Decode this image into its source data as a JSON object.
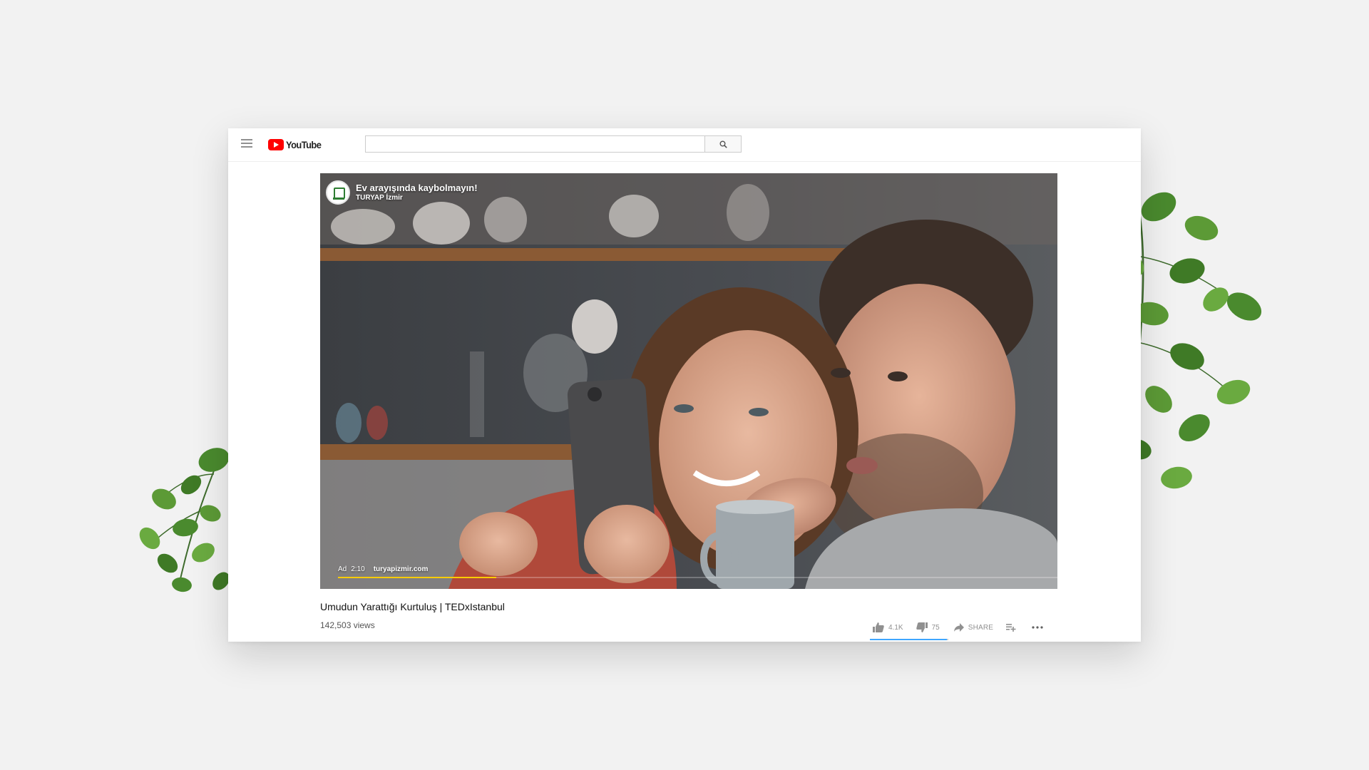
{
  "header": {
    "logo_text": "YouTube",
    "search_placeholder": ""
  },
  "player": {
    "ad": {
      "title": "Ev arayışında kaybolmayın!",
      "channel": "TURYAP İzmir",
      "badge": "Ad",
      "time": "2:10",
      "url": "turyapizmir.com",
      "progress_fraction": 0.22
    }
  },
  "video": {
    "title": "Umudun Yarattığı Kurtuluş | TEDxIstanbul",
    "views": "142,503 views"
  },
  "actions": {
    "likes": "4.1K",
    "dislikes": "75",
    "share_label": "SHARE",
    "sentiment_fraction": 0.98
  },
  "colors": {
    "brand_red": "#ff0000",
    "ad_progress": "#ffcc00",
    "sentiment_blue": "#3ea6ff"
  }
}
